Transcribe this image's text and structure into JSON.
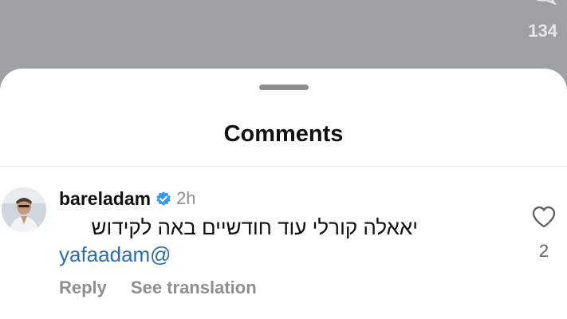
{
  "backdrop": {
    "comment_count": "134",
    "comment_icon": "speech-bubble-icon"
  },
  "sheet": {
    "title": "Comments"
  },
  "comment": {
    "username": "bareladam",
    "verified_icon": "verified-badge-icon",
    "time": "2h",
    "text": "יאאלה קורלי עוד חודשיים באה לקידוש",
    "mention": "yafaadam@",
    "actions": {
      "reply": "Reply",
      "see_translation": "See translation"
    },
    "like_icon": "heart-outline-icon",
    "like_count": "2"
  },
  "colors": {
    "backdrop": "#9da1a6",
    "verified": "#3897f0",
    "mention": "#2a6fa8",
    "secondary_text": "#8e8e93"
  }
}
